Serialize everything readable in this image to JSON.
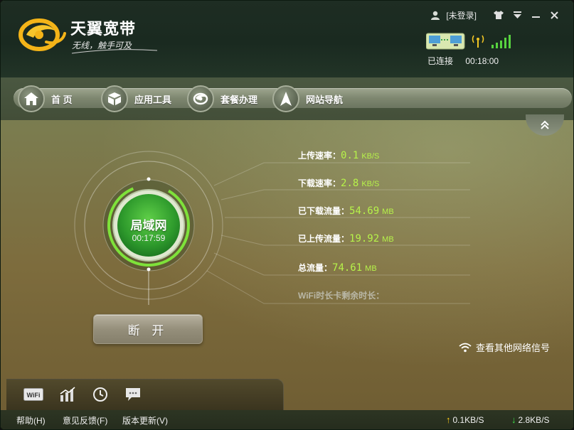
{
  "header": {
    "app_title": "天翼宽带",
    "slogan": "无线，触手可及",
    "login_label": "[未登录]",
    "status": "已连接",
    "elapsed": "00:18:00"
  },
  "nav": {
    "items": [
      {
        "label": "首 页",
        "icon": "home-icon"
      },
      {
        "label": "应用工具",
        "icon": "box-icon"
      },
      {
        "label": "套餐办理",
        "icon": "telecom-logo-icon"
      },
      {
        "label": "网站导航",
        "icon": "navigation-arrow-icon"
      }
    ]
  },
  "dial": {
    "network": "局域网",
    "time": "00:17:59"
  },
  "stats": {
    "upload_label": "上传速率：",
    "upload_value": "0.1",
    "upload_unit": "KB/S",
    "download_label": "下载速率：",
    "download_value": "2.8",
    "download_unit": "KB/S",
    "downloaded_label": "已下载流量：",
    "downloaded_value": "54.69",
    "downloaded_unit": "MB",
    "uploaded_label": "已上传流量：",
    "uploaded_value": "19.92",
    "uploaded_unit": "MB",
    "total_label": "总流量：",
    "total_value": "74.61",
    "total_unit": "MB",
    "wifi_remaining_label": "WiFi时长卡剩余时长："
  },
  "actions": {
    "disconnect_label": "断 开",
    "other_networks_label": "查看其他网络信号"
  },
  "statusbar": {
    "help": "帮助(H)",
    "feedback": "意见反馈(F)",
    "update": "版本更新(V)",
    "up_speed": "0.1KB/S",
    "down_speed": "2.8KB/S"
  },
  "colors": {
    "accent_green": "#b6f24a",
    "dial_green": "#45b83a",
    "up_arrow": "#ffcc1a",
    "down_arrow": "#3fe04a"
  }
}
